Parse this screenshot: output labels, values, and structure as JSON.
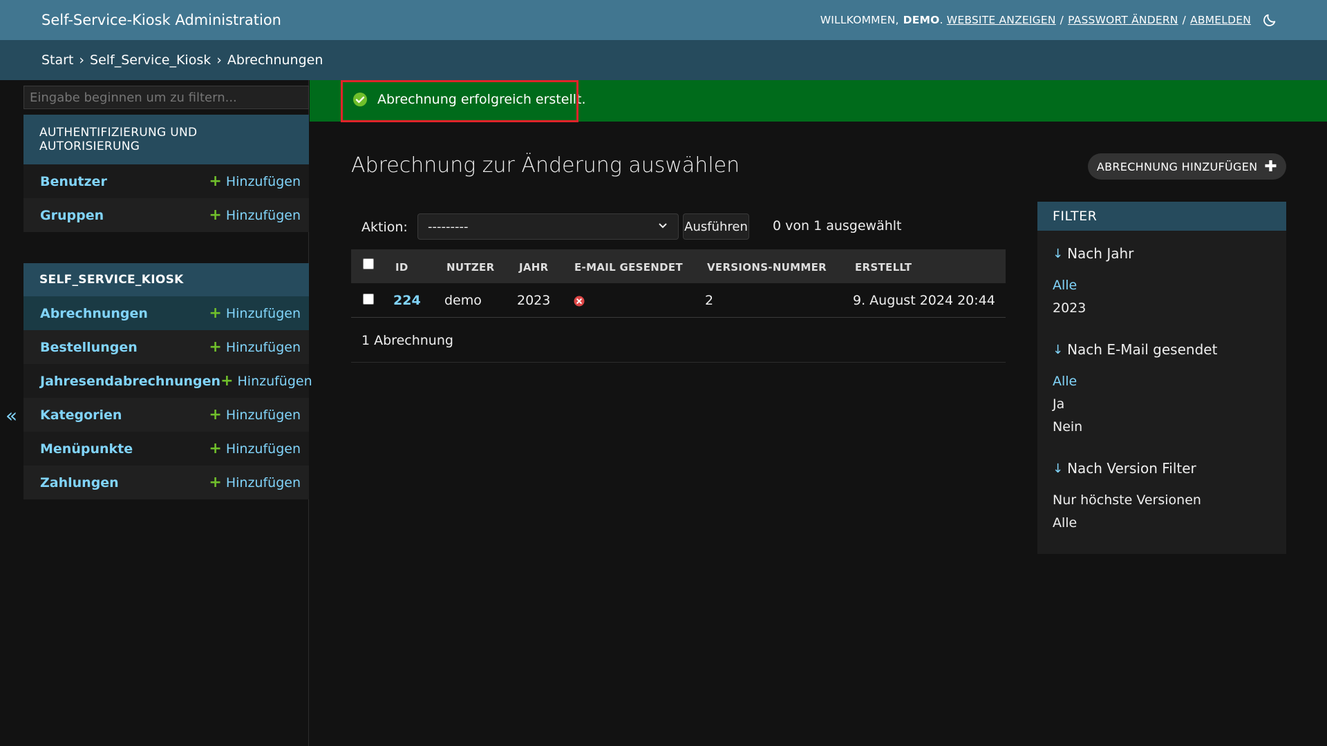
{
  "header": {
    "branding": "Self-Service-Kiosk Administration",
    "welcome": "Willkommen,",
    "username": "demo",
    "view_site": "Website anzeigen",
    "change_password": "Passwort ändern",
    "logout": "Abmelden",
    "separator": "/"
  },
  "breadcrumbs": {
    "home": "Start",
    "app": "Self_Service_Kiosk",
    "current": "Abrechnungen",
    "separator": "›"
  },
  "sidebar": {
    "filter_placeholder": "Eingabe beginnen um zu filtern...",
    "add_label": "Hinzufügen",
    "modules": [
      {
        "caption": "AUTHENTIFIZIERUNG UND AUTORISIERUNG",
        "models": [
          {
            "name": "Benutzer"
          },
          {
            "name": "Gruppen"
          }
        ]
      },
      {
        "caption": "SELF_SERVICE_KIOSK",
        "models": [
          {
            "name": "Abrechnungen",
            "active": true
          },
          {
            "name": "Bestellungen"
          },
          {
            "name": "Jahresendabrechnungen"
          },
          {
            "name": "Kategorien"
          },
          {
            "name": "Menüpunkte"
          },
          {
            "name": "Zahlungen"
          }
        ]
      }
    ],
    "collapse_icon": "«"
  },
  "message": {
    "text": "Abrechnung erfolgreich erstellt.",
    "icon": "check-circle-icon",
    "color": "#006b1b"
  },
  "content": {
    "title": "Abrechnung zur Änderung auswählen",
    "add_button": "Abrechnung hinzufügen",
    "action_label": "Aktion:",
    "action_selected": "---------",
    "go_button": "Ausführen",
    "selection_counter": "0 von 1 ausgewählt",
    "columns": [
      "ID",
      "NUTZER",
      "JAHR",
      "E-MAIL GESENDET",
      "VERSIONS-NUMMER",
      "ERSTELLT"
    ],
    "rows": [
      {
        "id": "224",
        "nutzer": "demo",
        "jahr": "2023",
        "email_gesendet": false,
        "version": "2",
        "erstellt": "9. August 2024 20:44"
      }
    ],
    "paginator": "1 Abrechnung"
  },
  "filter": {
    "title": "FILTER",
    "groups": [
      {
        "heading": "Nach Jahr",
        "choices": [
          "Alle",
          "2023"
        ],
        "selected": 0
      },
      {
        "heading": "Nach E-Mail gesendet",
        "choices": [
          "Alle",
          "Ja",
          "Nein"
        ],
        "selected": 0
      },
      {
        "heading": "Nach Version Filter",
        "choices": [
          "Nur höchste Versionen",
          "Alle"
        ],
        "selected": -1
      }
    ]
  },
  "colors": {
    "header": "#417690",
    "breadcrumbs": "#264b5d",
    "link": "#81d4fa",
    "add_green": "#70bf2b",
    "message_green": "#006b1b",
    "highlight_red": "#e0242a",
    "error_red": "#dd4646"
  }
}
